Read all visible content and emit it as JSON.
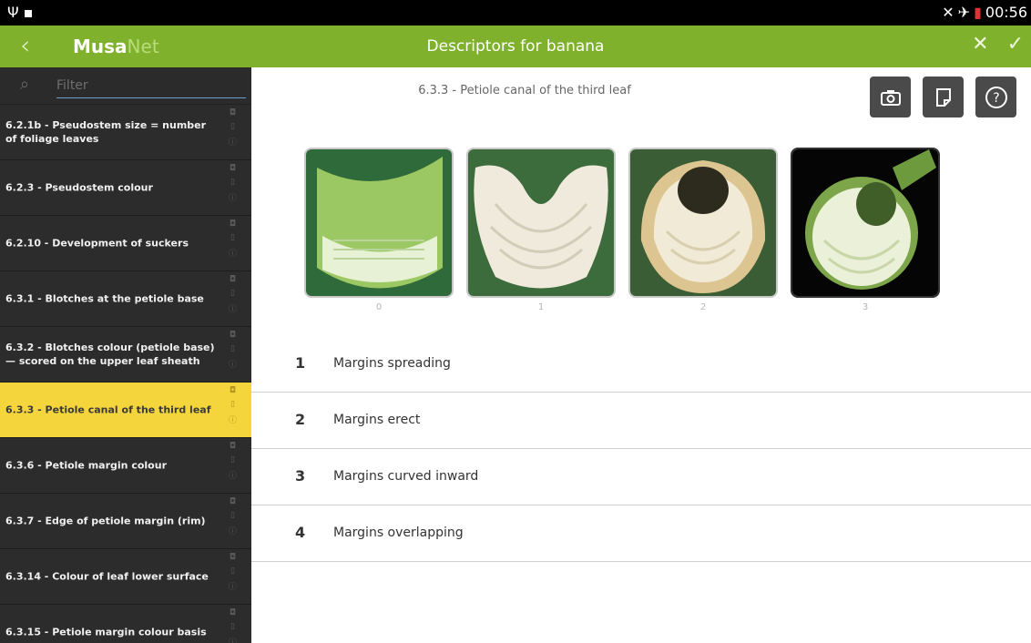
{
  "status_bar": {
    "time": "00:56"
  },
  "app_bar": {
    "logo_bold": "Musa",
    "logo_light": "Net",
    "title": "Descriptors for banana"
  },
  "sidebar": {
    "filter_placeholder": "Filter",
    "items": [
      {
        "label": "6.2.1b - Pseudostem size = number of foliage leaves"
      },
      {
        "label": "6.2.3 - Pseudostem colour"
      },
      {
        "label": "6.2.10 - Development of suckers"
      },
      {
        "label": "6.3.1 - Blotches at the petiole base"
      },
      {
        "label": "6.3.2 - Blotches colour (petiole base) — scored on the upper leaf sheath"
      },
      {
        "label": "6.3.3 - Petiole canal of the third leaf",
        "active": true
      },
      {
        "label": "6.3.6 - Petiole margin colour"
      },
      {
        "label": "6.3.7 - Edge of petiole margin (rim)"
      },
      {
        "label": "6.3.14 - Colour of leaf lower surface"
      },
      {
        "label": "6.3.15 - Petiole margin colour basis"
      }
    ]
  },
  "detail": {
    "title": "6.3.3 - Petiole canal of the third leaf",
    "gallery_markers": [
      "0",
      "1",
      "2",
      "3"
    ],
    "options": [
      {
        "num": "1",
        "text": "Margins spreading"
      },
      {
        "num": "2",
        "text": "Margins erect"
      },
      {
        "num": "3",
        "text": "Margins curved inward"
      },
      {
        "num": "4",
        "text": "Margins overlapping"
      }
    ]
  },
  "colors": {
    "app_bar": "#7fb12c",
    "active_item": "#f4d53b",
    "sidebar": "#2b2b2b"
  }
}
